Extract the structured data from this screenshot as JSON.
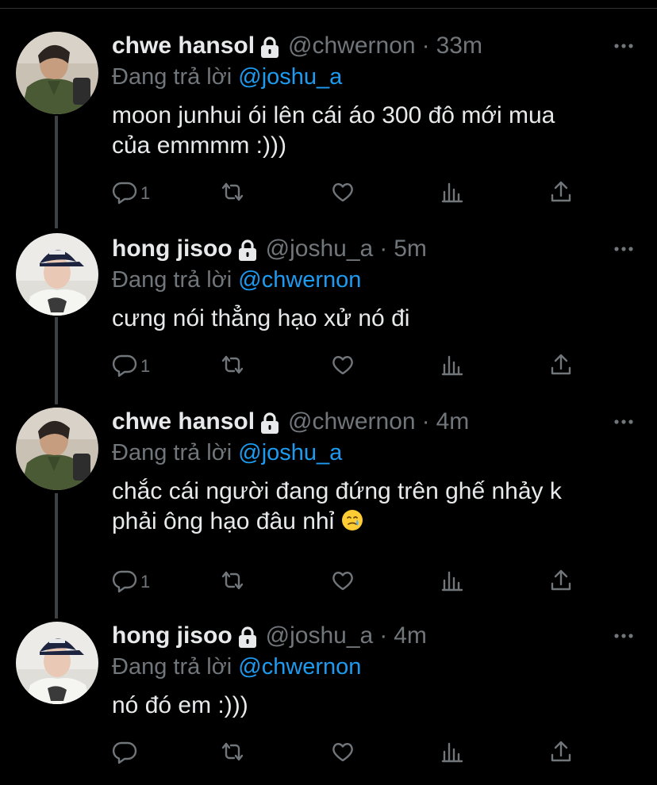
{
  "tweets": [
    {
      "name": "chwe hansol",
      "handle": "@chwernon",
      "separator": "·",
      "time": "33m",
      "reply_prefix": "Đang trả lời ",
      "reply_to": "@joshu_a",
      "lines": [
        "moon junhui ói lên cái áo 300 đô mới mua",
        "của emmmm :)))"
      ],
      "reply_count": "1",
      "avatar": "avatar-green"
    },
    {
      "name": "hong jisoo",
      "handle": "@joshu_a",
      "separator": "·",
      "time": "5m",
      "reply_prefix": "Đang trả lời ",
      "reply_to": "@chwernon",
      "lines": [
        "cưng nói thẳng hạo xử nó đi"
      ],
      "reply_count": "1",
      "avatar": "avatar-cap"
    },
    {
      "name": "chwe hansol",
      "handle": "@chwernon",
      "separator": "·",
      "time": "4m",
      "reply_prefix": "Đang trả lời ",
      "reply_to": "@joshu_a",
      "lines": [
        "chắc cái người đang đứng trên ghế nhảy k",
        "phải ông hạo đâu nhỉ"
      ],
      "emoji": "crying-face-emoji",
      "reply_count": "1",
      "avatar": "avatar-green"
    },
    {
      "name": "hong jisoo",
      "handle": "@joshu_a",
      "separator": "·",
      "time": "4m",
      "reply_prefix": "Đang trả lời ",
      "reply_to": "@chwernon",
      "lines": [
        "nó đó em :)))"
      ],
      "reply_count": "",
      "avatar": "avatar-cap"
    }
  ],
  "icons": {
    "lock": "lock-icon",
    "more": "more-icon",
    "reply": "reply-icon",
    "retweet": "retweet-icon",
    "like": "like-icon",
    "stats": "stats-icon",
    "share": "share-icon"
  },
  "colors": {
    "background": "#000000",
    "text": "#e7e9ea",
    "muted": "#71767b",
    "mention": "#1d9bf0"
  }
}
